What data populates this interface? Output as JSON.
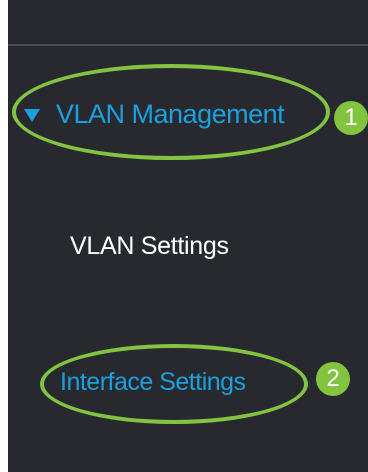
{
  "sidebar": {
    "section": {
      "label": "VLAN Management",
      "expanded": true
    },
    "items": [
      {
        "label": "VLAN Settings"
      },
      {
        "label": "Interface Settings"
      }
    ]
  },
  "callouts": [
    {
      "number": "1"
    },
    {
      "number": "2"
    }
  ],
  "colors": {
    "panel_background": "#27292e",
    "accent_blue": "#1ba0dd",
    "highlight_green": "#82c340",
    "text_white": "#ffffff"
  }
}
